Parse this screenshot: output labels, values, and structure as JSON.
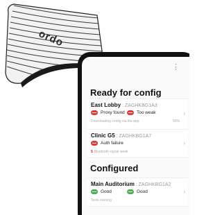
{
  "device": {
    "brand": "ordo"
  },
  "screen": {
    "menu_icon": "kebab-menu-icon",
    "ready_section": {
      "heading": "Ready for config",
      "items": [
        {
          "name": "East Lobby",
          "code": "ZAGHKBG1A3",
          "statuses": [
            {
              "label": "Proxy found",
              "color": "#e53935",
              "icon": "proxy-icon"
            },
            {
              "label": "Too weak",
              "color": "#e53935",
              "icon": "signal-weak-icon"
            }
          ],
          "subtext": "Downloading config via the app",
          "progress": "50%"
        },
        {
          "name": "Clinic G5",
          "code": "ZAGHKBG1A7",
          "statuses": [
            {
              "label": "Auth failure",
              "color": "#e53935",
              "icon": "auth-icon"
            }
          ],
          "subtext": "Bluetooth signal weak",
          "subtext_warning": true
        }
      ]
    },
    "configured_section": {
      "heading": "Configured",
      "items": [
        {
          "name": "Main Auditorium",
          "code": "ZAGHKBG1A2",
          "statuses": [
            {
              "label": "Good",
              "color": "#4caf50",
              "icon": "good-icon"
            },
            {
              "label": "Good",
              "color": "#4caf50",
              "icon": "good-icon"
            }
          ],
          "subtext": "Tests running"
        }
      ]
    },
    "colors": {
      "accent_red": "#e53935",
      "good_green": "#4caf50",
      "phone_body": "#111111"
    }
  }
}
